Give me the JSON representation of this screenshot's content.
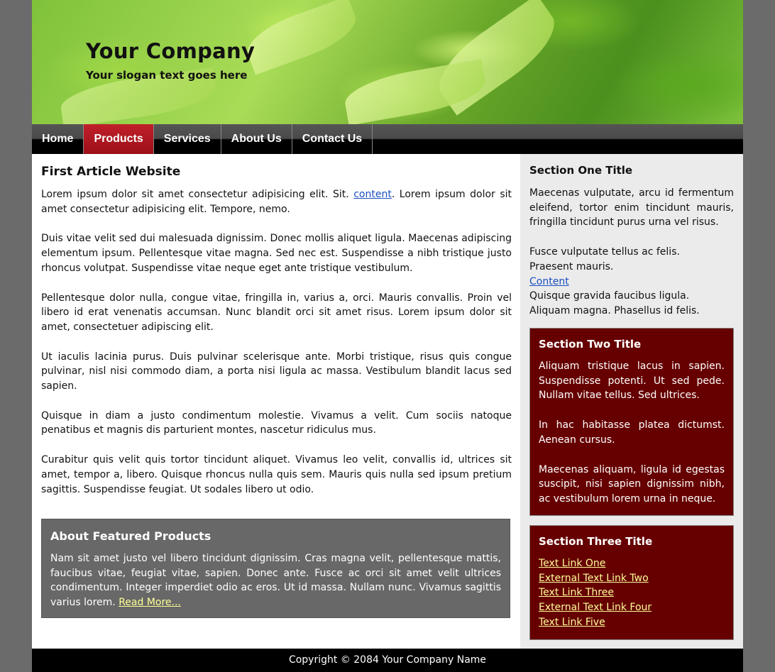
{
  "header": {
    "company": "Your Company",
    "slogan": "Your slogan text goes here"
  },
  "nav": {
    "items": [
      "Home",
      "Products",
      "Services",
      "About Us",
      "Contact Us"
    ],
    "active": "Products"
  },
  "main": {
    "title": "First Article Website",
    "p1_before": "Lorem ipsum dolor sit amet consectetur adipisicing elit. Sit. ",
    "p1_link": "content",
    "p1_after": ". Lorem ipsum dolor sit amet consectetur adipisicing elit. Tempore, nemo.",
    "p2": "Duis vitae velit sed dui malesuada dignissim. Donec mollis aliquet ligula. Maecenas adipiscing elementum ipsum. Pellentesque vitae magna. Sed nec est. Suspendisse a nibh tristique justo rhoncus volutpat. Suspendisse vitae neque eget ante tristique vestibulum.",
    "p3": "Pellentesque dolor nulla, congue vitae, fringilla in, varius a, orci. Mauris convallis. Proin vel libero id erat venenatis accumsan. Nunc blandit orci sit amet risus. Lorem ipsum dolor sit amet, consectetuer adipiscing elit.",
    "p4": "Ut iaculis lacinia purus. Duis pulvinar scelerisque ante. Morbi tristique, risus quis congue pulvinar, nisl nisi commodo diam, a porta nisi ligula ac massa. Vestibulum blandit lacus sed sapien.",
    "p5": "Quisque in diam a justo condimentum molestie. Vivamus a velit. Cum sociis natoque penatibus et magnis dis parturient montes, nascetur ridiculus mus.",
    "p6": "Curabitur quis velit quis tortor tincidunt aliquet. Vivamus leo velit, convallis id, ultrices sit amet, tempor a, libero. Quisque rhoncus nulla quis sem. Mauris quis nulla sed ipsum pretium sagittis. Suspendisse feugiat. Ut sodales libero ut odio."
  },
  "featured": {
    "title": "About Featured Products",
    "text": "Nam sit amet justo vel libero tincidunt dignissim. Cras magna velit, pellentesque mattis, faucibus vitae, feugiat vitae, sapien. Donec ante. Fusce ac orci sit amet velit ultrices condimentum. Integer imperdiet odio ac eros. Ut id massa. Nullam nunc. Vivamus sagittis varius lorem. ",
    "read_more": "Read More..."
  },
  "section_one": {
    "title": "Section One Title",
    "text": "Maecenas vulputate, arcu id fermentum eleifend, tortor enim tincidunt mauris, fringilla tincidunt purus urna vel risus.",
    "line1": "Fusce vulputate tellus ac felis.",
    "line2": "Praesent mauris.",
    "link": "Content",
    "line3": "Quisque gravida faucibus ligula.",
    "line4": "Aliquam magna. Phasellus id felis."
  },
  "section_two": {
    "title": "Section Two Title",
    "p1": "Aliquam tristique lacus in sapien. Suspendisse potenti. Ut sed pede. Nullam vitae tellus. Sed ultrices.",
    "p2": "In hac habitasse platea dictumst. Aenean cursus.",
    "p3": "Maecenas aliquam, ligula id egestas suscipit, nisi sapien dignissim nibh, ac vestibulum lorem urna in neque."
  },
  "section_three": {
    "title": "Section Three Title",
    "links": [
      "Text Link One",
      "External Text Link Two",
      "Text Link Three",
      "External Text Link Four",
      "Text Link Five"
    ]
  },
  "footer": {
    "copyright": "Copyright © 2084 Your Company Name"
  },
  "colors": {
    "page_bg": "#6b6b6b",
    "nav_active": "#b0141e",
    "sidebar_bg": "#ebebeb",
    "red_box": "#660000",
    "featured_box": "#686868",
    "link_blue": "#1a4fc0",
    "link_yellow": "#ffff99"
  }
}
